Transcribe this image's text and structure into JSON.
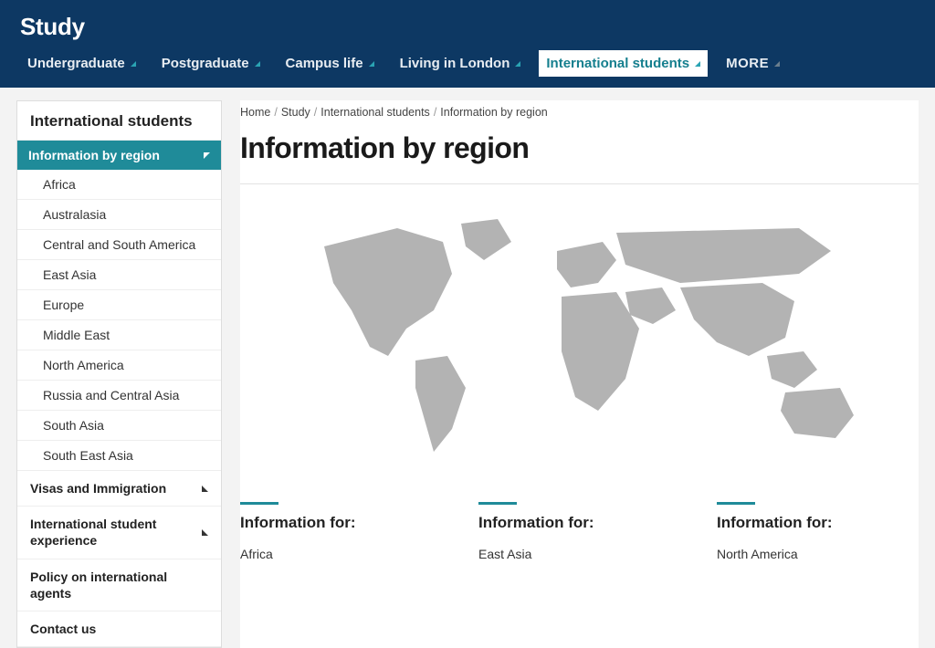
{
  "header": {
    "title": "Study",
    "nav": [
      {
        "label": "Undergraduate"
      },
      {
        "label": "Postgraduate"
      },
      {
        "label": "Campus life"
      },
      {
        "label": "Living in London"
      },
      {
        "label": "International students",
        "active": true
      },
      {
        "label": "MORE",
        "more": true
      }
    ]
  },
  "sidebar": {
    "title": "International students",
    "selected": "Information by region",
    "regions": [
      "Africa",
      "Australasia",
      "Central and South America",
      "East Asia",
      "Europe",
      "Middle East",
      "North America",
      "Russia and Central Asia",
      "South Asia",
      "South East Asia"
    ],
    "mains": [
      {
        "label": "Visas and Immigration",
        "arrow": true
      },
      {
        "label": "International student experience",
        "arrow": true
      },
      {
        "label": "Policy on international agents",
        "arrow": false
      },
      {
        "label": "Contact us",
        "arrow": false
      }
    ]
  },
  "breadcrumb": [
    "Home",
    "Study",
    "International students",
    "Information by region"
  ],
  "page_title": "Information by region",
  "columns": [
    {
      "title": "Information for:",
      "links": [
        "Africa"
      ]
    },
    {
      "title": "Information for:",
      "links": [
        "East Asia"
      ]
    },
    {
      "title": "Information for:",
      "links": [
        "North America"
      ]
    }
  ]
}
